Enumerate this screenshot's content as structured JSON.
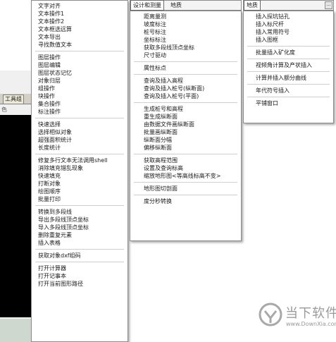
{
  "background_app": {
    "tab_label": "工具组",
    "sub_label": "色"
  },
  "menu1": {
    "groups": [
      [
        "文字对齐",
        "文本操作1",
        "文本操作2",
        "文本框选远算",
        "文本导出",
        "寻找数值文本"
      ],
      [
        "图层操作",
        "图层编辑",
        "图层状态记忆",
        "对象归层",
        "组操作",
        "块操作",
        "集合操作",
        "标注操作"
      ],
      [
        "快速选择",
        "选择相似对象",
        "超强面积统计",
        "长度统计"
      ],
      [
        "修复多行文本无法调用shell",
        "消除填充错乱现象",
        "快速填充",
        "打断对象",
        "绘图顺序",
        "批量打印"
      ],
      [
        "转换到多段线",
        "导出多段线顶点坐标",
        "导入多段线顶点坐标",
        "删除重复元素",
        "插入表格"
      ],
      [
        "获取对象dxf组码"
      ],
      [
        "打开计算器",
        "打开记事本",
        "打开当前图形路径"
      ]
    ]
  },
  "headbar2": {
    "tab1": "设计和测量",
    "tab2": "地质"
  },
  "menu2": {
    "groups": [
      [
        "距离量测",
        "坡度标注",
        "桩号标注",
        "坐标标注",
        "获取多段线顶点坐标",
        "尺寸驱动"
      ],
      [
        "属性标点"
      ],
      [
        "查询及插入高程",
        "查询及插入桩号(纵断面)",
        "查询及插入桩号(平面)"
      ],
      [
        "生成桩号和高程",
        "重生成纵断面",
        "由数据文件画纵断面",
        "批量画纵断面",
        "纵断面分幅",
        "偏移纵断面"
      ],
      [
        "获取高程范围",
        "设置及查询标高",
        "缩放地形图<等高线标高不变>"
      ],
      [
        "地形图切剖面"
      ],
      [
        "度分秒转换"
      ]
    ]
  },
  "headbar3": {
    "tab1": "地质",
    "dropdown_icon": "ellipsis"
  },
  "menu3": {
    "groups": [
      [
        "插入探坑钻孔",
        "插入标尺杆",
        "插入常用符号",
        "插入图框"
      ],
      [
        "批量插入矿化度"
      ],
      [
        "视倾角计算及产状插入"
      ],
      [
        "计算并插入额分曲线"
      ],
      [
        "年代符号插入"
      ],
      [
        "平铺窗口"
      ]
    ]
  },
  "watermark": {
    "text": "当下软件园",
    "url": "www.DownXia.com",
    "color": "#9a9a9a"
  }
}
